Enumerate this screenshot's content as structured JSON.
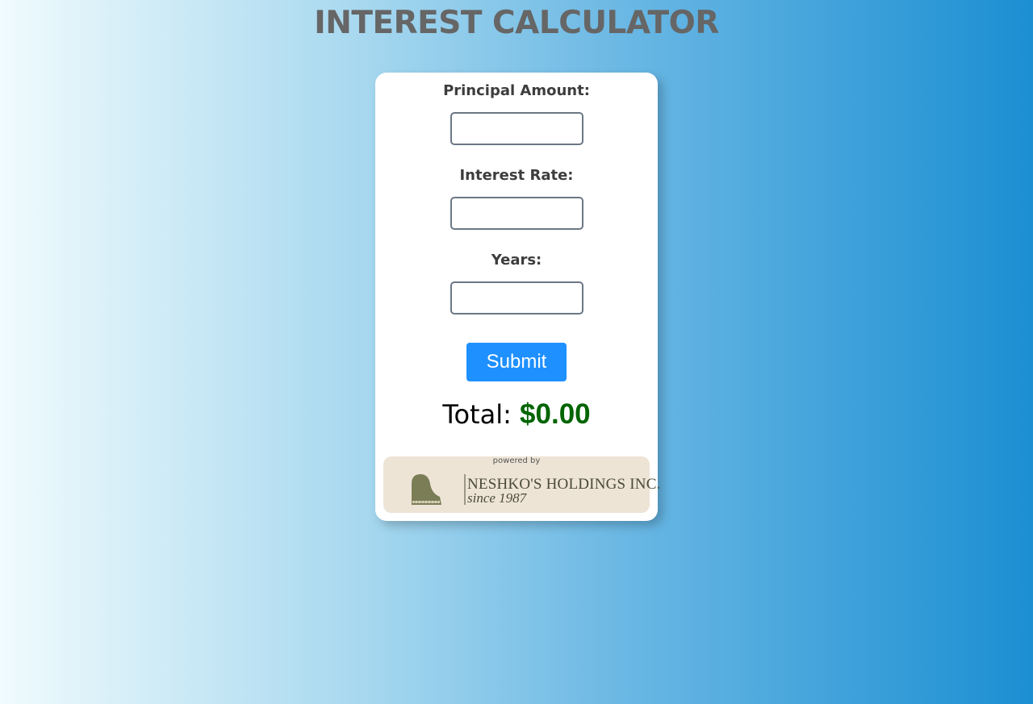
{
  "page": {
    "title": "INTEREST CALCULATOR"
  },
  "form": {
    "principal_label": "Principal Amount:",
    "principal_value": "",
    "rate_label": "Interest Rate:",
    "rate_value": "",
    "years_label": "Years:",
    "years_value": "",
    "submit_label": "Submit"
  },
  "result": {
    "label": "Total:",
    "value": "$0.00",
    "value_color": "#006400"
  },
  "footer": {
    "powered_by": "powered by",
    "company_name": "NESHKO'S HOLDINGS INC.",
    "since": "since 1987",
    "logo_icon": "grand-piano-icon"
  },
  "colors": {
    "accent": "#1e90ff",
    "title": "#666666",
    "badge_bg": "#ede4d6"
  }
}
